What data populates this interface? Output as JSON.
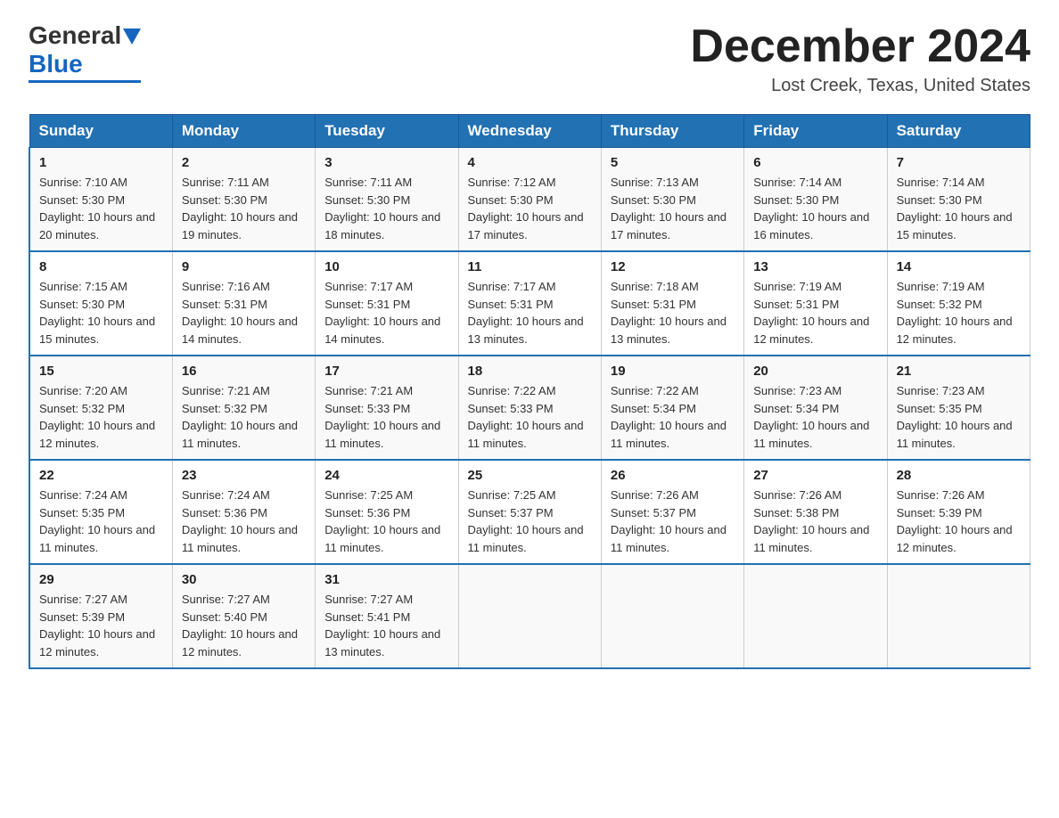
{
  "logo": {
    "line1": "General",
    "triangle": "▶",
    "line2": "Blue"
  },
  "title": "December 2024",
  "location": "Lost Creek, Texas, United States",
  "days_of_week": [
    "Sunday",
    "Monday",
    "Tuesday",
    "Wednesday",
    "Thursday",
    "Friday",
    "Saturday"
  ],
  "weeks": [
    [
      {
        "day": "1",
        "sunrise": "7:10 AM",
        "sunset": "5:30 PM",
        "daylight": "10 hours and 20 minutes."
      },
      {
        "day": "2",
        "sunrise": "7:11 AM",
        "sunset": "5:30 PM",
        "daylight": "10 hours and 19 minutes."
      },
      {
        "day": "3",
        "sunrise": "7:11 AM",
        "sunset": "5:30 PM",
        "daylight": "10 hours and 18 minutes."
      },
      {
        "day": "4",
        "sunrise": "7:12 AM",
        "sunset": "5:30 PM",
        "daylight": "10 hours and 17 minutes."
      },
      {
        "day": "5",
        "sunrise": "7:13 AM",
        "sunset": "5:30 PM",
        "daylight": "10 hours and 17 minutes."
      },
      {
        "day": "6",
        "sunrise": "7:14 AM",
        "sunset": "5:30 PM",
        "daylight": "10 hours and 16 minutes."
      },
      {
        "day": "7",
        "sunrise": "7:14 AM",
        "sunset": "5:30 PM",
        "daylight": "10 hours and 15 minutes."
      }
    ],
    [
      {
        "day": "8",
        "sunrise": "7:15 AM",
        "sunset": "5:30 PM",
        "daylight": "10 hours and 15 minutes."
      },
      {
        "day": "9",
        "sunrise": "7:16 AM",
        "sunset": "5:31 PM",
        "daylight": "10 hours and 14 minutes."
      },
      {
        "day": "10",
        "sunrise": "7:17 AM",
        "sunset": "5:31 PM",
        "daylight": "10 hours and 14 minutes."
      },
      {
        "day": "11",
        "sunrise": "7:17 AM",
        "sunset": "5:31 PM",
        "daylight": "10 hours and 13 minutes."
      },
      {
        "day": "12",
        "sunrise": "7:18 AM",
        "sunset": "5:31 PM",
        "daylight": "10 hours and 13 minutes."
      },
      {
        "day": "13",
        "sunrise": "7:19 AM",
        "sunset": "5:31 PM",
        "daylight": "10 hours and 12 minutes."
      },
      {
        "day": "14",
        "sunrise": "7:19 AM",
        "sunset": "5:32 PM",
        "daylight": "10 hours and 12 minutes."
      }
    ],
    [
      {
        "day": "15",
        "sunrise": "7:20 AM",
        "sunset": "5:32 PM",
        "daylight": "10 hours and 12 minutes."
      },
      {
        "day": "16",
        "sunrise": "7:21 AM",
        "sunset": "5:32 PM",
        "daylight": "10 hours and 11 minutes."
      },
      {
        "day": "17",
        "sunrise": "7:21 AM",
        "sunset": "5:33 PM",
        "daylight": "10 hours and 11 minutes."
      },
      {
        "day": "18",
        "sunrise": "7:22 AM",
        "sunset": "5:33 PM",
        "daylight": "10 hours and 11 minutes."
      },
      {
        "day": "19",
        "sunrise": "7:22 AM",
        "sunset": "5:34 PM",
        "daylight": "10 hours and 11 minutes."
      },
      {
        "day": "20",
        "sunrise": "7:23 AM",
        "sunset": "5:34 PM",
        "daylight": "10 hours and 11 minutes."
      },
      {
        "day": "21",
        "sunrise": "7:23 AM",
        "sunset": "5:35 PM",
        "daylight": "10 hours and 11 minutes."
      }
    ],
    [
      {
        "day": "22",
        "sunrise": "7:24 AM",
        "sunset": "5:35 PM",
        "daylight": "10 hours and 11 minutes."
      },
      {
        "day": "23",
        "sunrise": "7:24 AM",
        "sunset": "5:36 PM",
        "daylight": "10 hours and 11 minutes."
      },
      {
        "day": "24",
        "sunrise": "7:25 AM",
        "sunset": "5:36 PM",
        "daylight": "10 hours and 11 minutes."
      },
      {
        "day": "25",
        "sunrise": "7:25 AM",
        "sunset": "5:37 PM",
        "daylight": "10 hours and 11 minutes."
      },
      {
        "day": "26",
        "sunrise": "7:26 AM",
        "sunset": "5:37 PM",
        "daylight": "10 hours and 11 minutes."
      },
      {
        "day": "27",
        "sunrise": "7:26 AM",
        "sunset": "5:38 PM",
        "daylight": "10 hours and 11 minutes."
      },
      {
        "day": "28",
        "sunrise": "7:26 AM",
        "sunset": "5:39 PM",
        "daylight": "10 hours and 12 minutes."
      }
    ],
    [
      {
        "day": "29",
        "sunrise": "7:27 AM",
        "sunset": "5:39 PM",
        "daylight": "10 hours and 12 minutes."
      },
      {
        "day": "30",
        "sunrise": "7:27 AM",
        "sunset": "5:40 PM",
        "daylight": "10 hours and 12 minutes."
      },
      {
        "day": "31",
        "sunrise": "7:27 AM",
        "sunset": "5:41 PM",
        "daylight": "10 hours and 13 minutes."
      },
      {
        "day": "",
        "sunrise": "",
        "sunset": "",
        "daylight": ""
      },
      {
        "day": "",
        "sunrise": "",
        "sunset": "",
        "daylight": ""
      },
      {
        "day": "",
        "sunrise": "",
        "sunset": "",
        "daylight": ""
      },
      {
        "day": "",
        "sunrise": "",
        "sunset": "",
        "daylight": ""
      }
    ]
  ]
}
